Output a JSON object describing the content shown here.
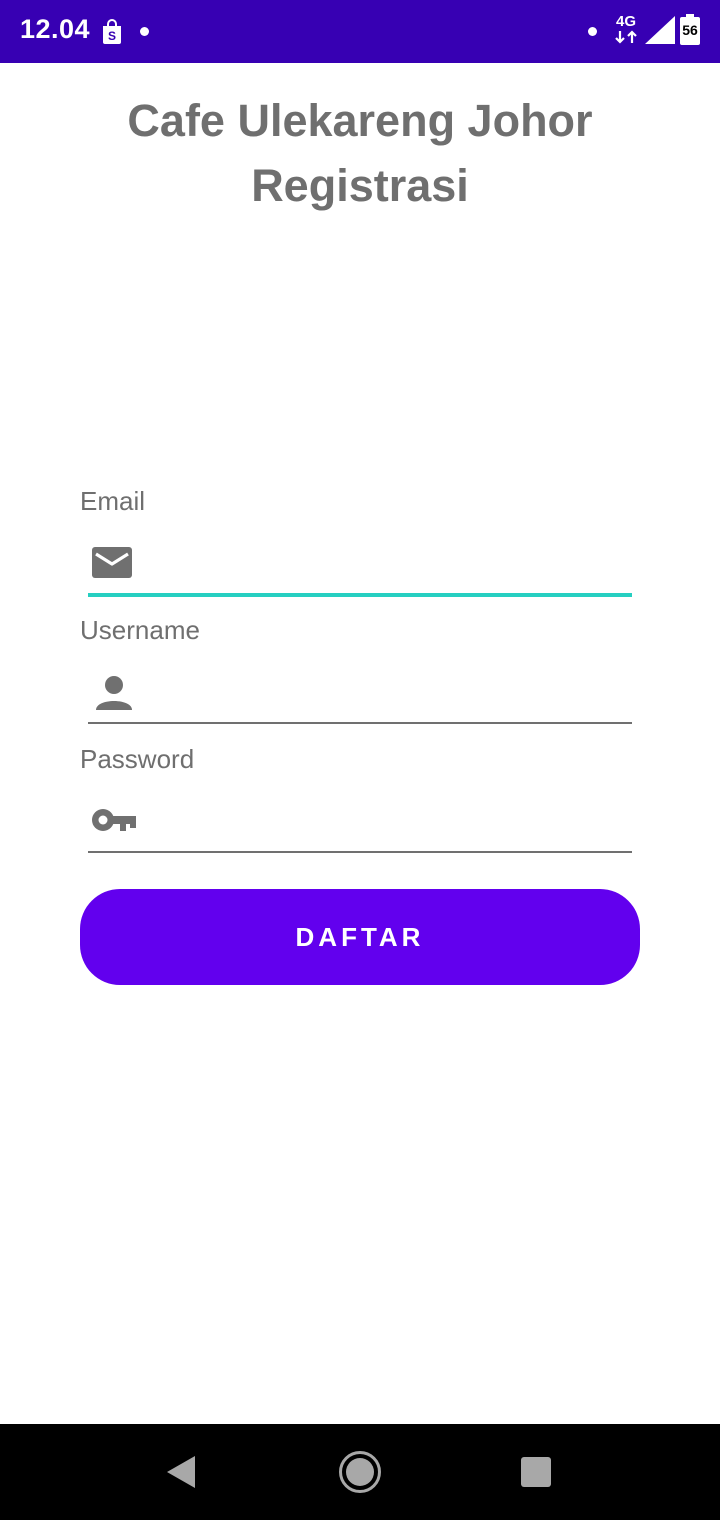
{
  "status_bar": {
    "time": "12.04",
    "network": "4G",
    "battery": "56",
    "icons": [
      "shopping-bag-icon",
      "notification-dot-icon",
      "network-4g-icon",
      "signal-icon",
      "battery-icon"
    ]
  },
  "header": {
    "title_line1": "Cafe Ulekareng Johor",
    "title_line2": "Registrasi"
  },
  "form": {
    "email": {
      "label": "Email",
      "value": "",
      "icon": "email-icon"
    },
    "username": {
      "label": "Username",
      "value": "",
      "icon": "person-icon"
    },
    "password": {
      "label": "Password",
      "value": "",
      "icon": "key-icon"
    },
    "submit_label": "DAFTAR"
  },
  "colors": {
    "status_bar": "#3700b3",
    "primary": "#6200ee",
    "focus_accent": "#26cfc1",
    "text_gray": "#6f6f6f"
  },
  "nav_bar": {
    "icons": [
      "back-icon",
      "home-icon",
      "recent-apps-icon"
    ]
  }
}
